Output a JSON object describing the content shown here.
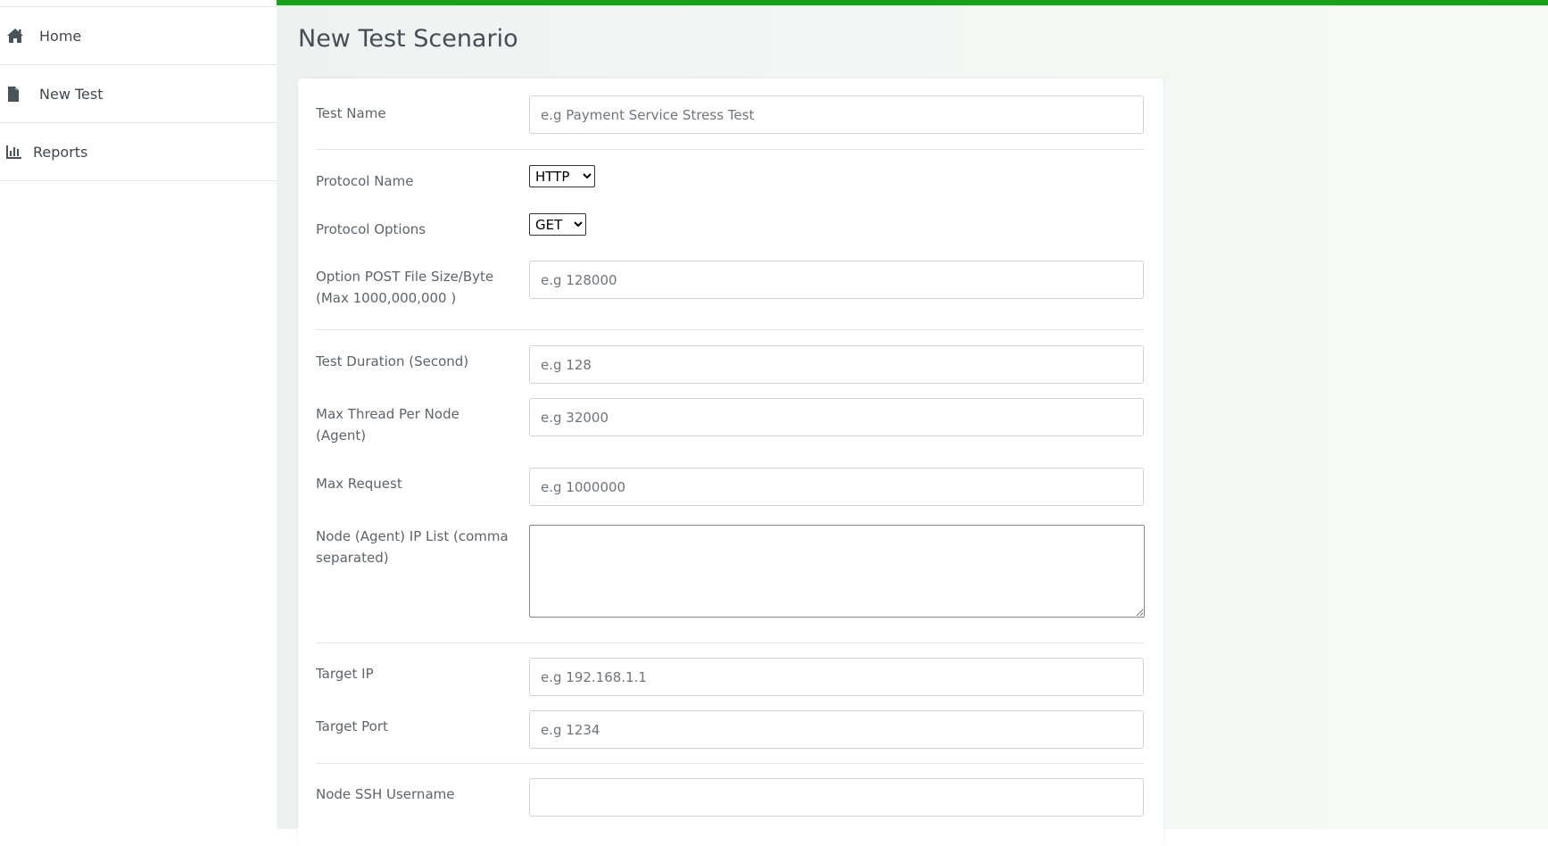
{
  "sidebar": {
    "items": [
      {
        "label": "Home",
        "icon": "home-icon"
      },
      {
        "label": "New Test",
        "icon": "file-icon"
      },
      {
        "label": "Reports",
        "icon": "bar-chart-icon"
      }
    ]
  },
  "colors": {
    "progress": "#1a9f1a",
    "accent_bg": "#f3f6f4"
  },
  "page": {
    "title": "New Test Scenario"
  },
  "form": {
    "test_name": {
      "label": "Test Name",
      "placeholder": "e.g Payment Service Stress Test"
    },
    "protocol_name": {
      "label": "Protocol Name",
      "selected": "HTTP"
    },
    "protocol_options": {
      "label": "Protocol Options",
      "selected": "GET"
    },
    "post_file_size": {
      "label": "Option POST File Size/Byte (Max 1000,000,000 )",
      "placeholder": "e.g 128000"
    },
    "test_duration": {
      "label": "Test Duration (Second)",
      "placeholder": "e.g 128"
    },
    "max_thread": {
      "label": "Max Thread Per Node (Agent)",
      "placeholder": "e.g 32000"
    },
    "max_request": {
      "label": "Max Request",
      "placeholder": "e.g 1000000"
    },
    "node_ip_list": {
      "label": "Node (Agent) IP List (comma separated)"
    },
    "target_ip": {
      "label": "Target IP",
      "placeholder": "e.g 192.168.1.1"
    },
    "target_port": {
      "label": "Target Port",
      "placeholder": "e.g 1234"
    },
    "ssh_username": {
      "label": "Node SSH Username"
    }
  }
}
